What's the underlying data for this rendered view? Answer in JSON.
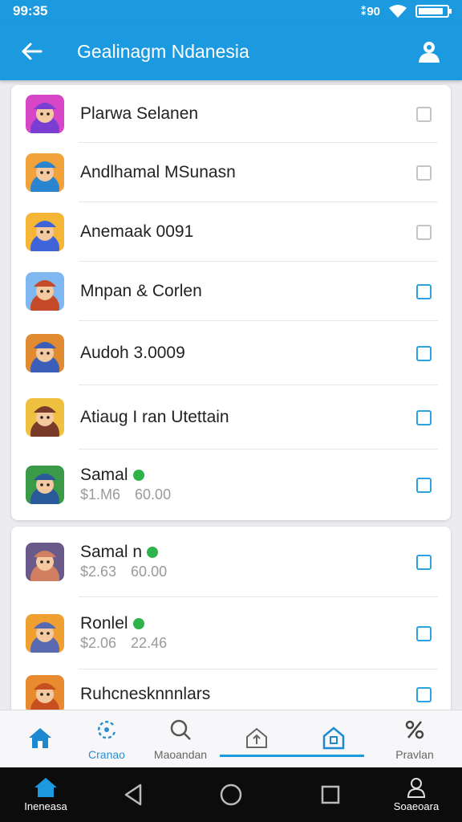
{
  "status_bar": {
    "time": "99:35",
    "signal_text": "⁑90"
  },
  "app_bar": {
    "title": "Gealinagm Ndanesia"
  },
  "list_card_1": [
    {
      "name": "Plarwa Selanen",
      "price": "",
      "price_secondary": "",
      "verified": false,
      "checkbox_color": "#c4c4c4",
      "icon_colors": [
        "#d846c8",
        "#7a3fd0"
      ]
    },
    {
      "name": "Andlhamal MSunasn",
      "price": "",
      "price_secondary": "",
      "verified": false,
      "checkbox_color": "#c4c4c4",
      "icon_colors": [
        "#f2a23a",
        "#2a84d0"
      ]
    },
    {
      "name": "Anemaak 0091",
      "price": "",
      "price_secondary": "",
      "verified": false,
      "checkbox_color": "#c4c4c4",
      "icon_colors": [
        "#f5b638",
        "#3f63d8"
      ]
    },
    {
      "name": "Mnpan & Corlen",
      "price": "",
      "price_secondary": "",
      "verified": false,
      "checkbox_color": "#2aa3e0",
      "icon_colors": [
        "#7fb8f0",
        "#c44a2a"
      ]
    },
    {
      "name": "Audoh 3.0009",
      "price": "",
      "price_secondary": "",
      "verified": false,
      "checkbox_color": "#2aa3e0",
      "icon_colors": [
        "#e08a32",
        "#3b5fb8"
      ]
    },
    {
      "name": "Atiaug I ran Utettain",
      "price": "",
      "price_secondary": "",
      "verified": false,
      "checkbox_color": "#2aa3e0",
      "icon_colors": [
        "#f0c040",
        "#7a3a2a"
      ]
    },
    {
      "name": "Samal",
      "price": "$1.M6",
      "price_secondary": "60.00",
      "verified": true,
      "checkbox_color": "#2aa3e0",
      "icon_colors": [
        "#3a9a48",
        "#2a5a9a"
      ]
    }
  ],
  "list_card_2": [
    {
      "name": "Samal n",
      "price": "$2.63",
      "price_secondary": "60.00",
      "verified": true,
      "checkbox_color": "#2aa3e0",
      "icon_colors": [
        "#6a5a8a",
        "#d08060"
      ]
    },
    {
      "name": "Ronlel",
      "price": "$2.06",
      "price_secondary": "22.46",
      "verified": true,
      "checkbox_color": "#2aa3e0",
      "icon_colors": [
        "#f0a030",
        "#5a6ab0"
      ]
    },
    {
      "name": "Ruhcnesknnnlars",
      "price": "",
      "price_secondary": "",
      "verified": false,
      "checkbox_color": "#2aa3e0",
      "icon_colors": [
        "#e88a30",
        "#c85020"
      ]
    }
  ],
  "bottom_tabs": [
    {
      "label": "",
      "icon": "home-icon",
      "active": true
    },
    {
      "label": "Cranao",
      "icon": "refresh-icon",
      "active": true
    },
    {
      "label": "Maoandan",
      "icon": "search-icon",
      "active": false
    },
    {
      "label": "",
      "icon": "upload-icon",
      "active": false
    },
    {
      "label": "",
      "icon": "store-icon",
      "active": true
    },
    {
      "label": "Pravlan",
      "icon": "percent-icon",
      "active": false
    }
  ],
  "nav_bar": {
    "home_label": "Ineneasa",
    "profile_label": "Soaeoara"
  },
  "colors": {
    "primary": "#1c9ae0",
    "accent": "#2aa3e0",
    "verified": "#2db34a"
  }
}
